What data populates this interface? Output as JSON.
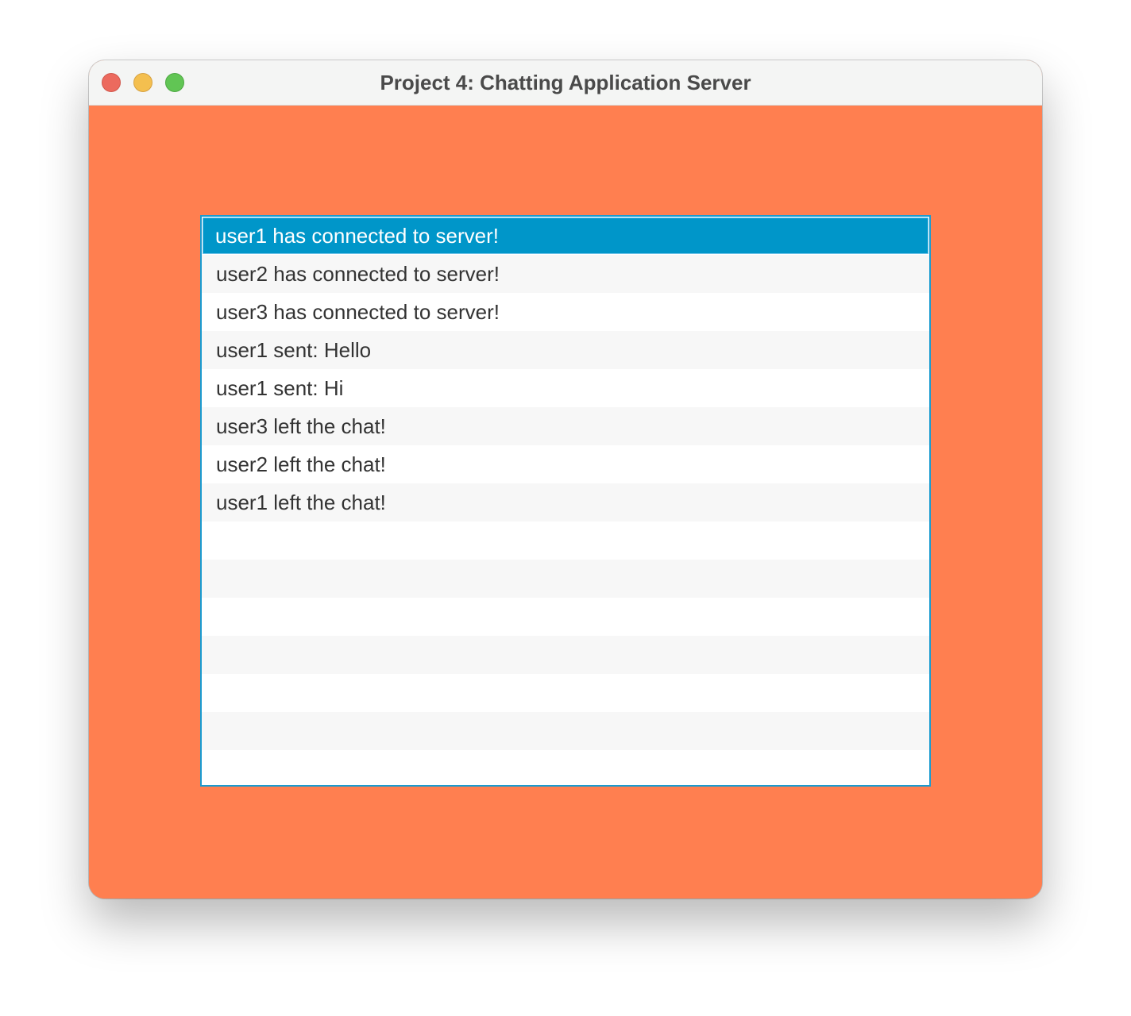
{
  "window": {
    "title": "Project 4: Chatting Application Server"
  },
  "colors": {
    "background": "#ff7f50",
    "selection": "#0096c9",
    "list_border": "#1a9bd0"
  },
  "list": {
    "items": [
      "user1 has connected to server!",
      "user2 has connected to server!",
      "user3 has connected to server!",
      "user1 sent: Hello",
      "user1 sent: Hi",
      "user3 left the chat!",
      "user2 left the chat!",
      "user1 left the chat!"
    ],
    "selected_index": 0
  }
}
